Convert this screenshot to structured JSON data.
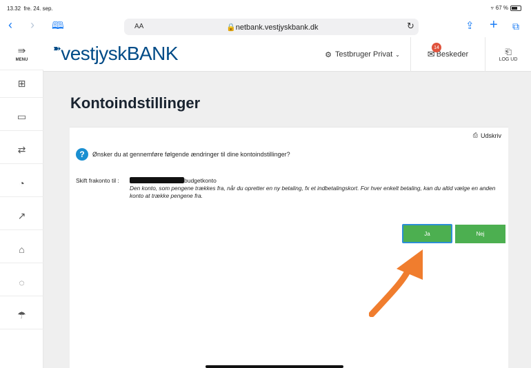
{
  "status_bar": {
    "time": "13.32",
    "date": "fre. 24. sep.",
    "battery": "67 %"
  },
  "browser": {
    "text_size": "AA",
    "url": "netbank.vestjyskbank.dk"
  },
  "sidebar": {
    "menu_label": "MENU",
    "items": [
      {
        "icon": "grid-icon"
      },
      {
        "icon": "card-icon"
      },
      {
        "icon": "transfer-icon"
      },
      {
        "icon": "pie-chart-icon"
      },
      {
        "icon": "growth-chart-icon"
      },
      {
        "icon": "house-icon"
      },
      {
        "icon": "piggy-bank-icon"
      },
      {
        "icon": "umbrella-icon"
      }
    ]
  },
  "header": {
    "logo_prefix": "vestjysk",
    "logo_suffix": "BANK",
    "user_label": "Testbruger Privat",
    "messages_label": "Beskeder",
    "messages_count": "14",
    "logout_label": "LOG UD"
  },
  "page": {
    "title": "Kontoindstillinger",
    "print_label": "Udskriv",
    "question": "Ønsker du at gennemføre følgende ændringer til dine kontoindstillinger?",
    "change_label": "Skift frakonto til :",
    "change_account_name": "budgetkonto",
    "description": "Den konto, som pengene trækkes fra, når du opretter en ny betaling, fx et indbetalingskort. For hver enkelt betaling, kan du altid vælge en anden konto at trække pengene fra.",
    "yes_label": "Ja",
    "no_label": "Nej"
  },
  "colors": {
    "brand_blue": "#004b87",
    "button_green": "#4caf50",
    "focus_blue": "#2c8fd6",
    "badge_red": "#e0533d",
    "arrow_orange": "#f07d2e"
  }
}
